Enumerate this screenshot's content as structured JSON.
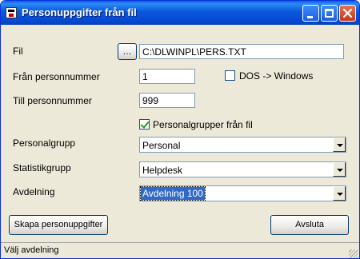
{
  "window": {
    "title": "Personuppgifter från fil"
  },
  "form": {
    "fil_label": "Fil",
    "browse_label": "...",
    "fil_value": "C:\\DLWINPL\\PERS.TXT",
    "fran_label": "Från personnummer",
    "fran_value": "1",
    "dos_label": "DOS -> Windows",
    "dos_checked": false,
    "till_label": "Till personnummer",
    "till_value": "999",
    "personalgrupper_label": "Personalgrupper från fil",
    "personalgrupper_checked": true,
    "personalgrupp_label": "Personalgrupp",
    "personalgrupp_value": "Personal",
    "statistikgrupp_label": "Statistikgrupp",
    "statistikgrupp_value": "Helpdesk",
    "avdelning_label": "Avdelning",
    "avdelning_value": "Avdelning 100"
  },
  "buttons": {
    "skapa_label": "Skapa personuppgifter",
    "avsluta_label": "Avsluta"
  },
  "status": {
    "text": "Välj avdelning"
  },
  "colors": {
    "titlebar": "#0a58dc",
    "dialog_bg": "#ece9d8",
    "selection": "#316ac5",
    "close_button": "#c4381a"
  }
}
